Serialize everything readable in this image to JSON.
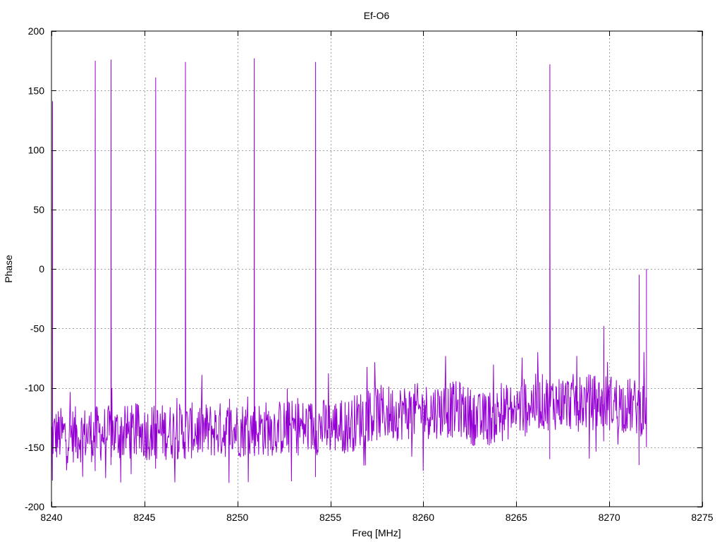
{
  "chart_data": {
    "type": "line",
    "title": "Ef-O6",
    "xlabel": "Freq [MHz]",
    "ylabel": "Phase",
    "xlim": [
      8240,
      8275
    ],
    "ylim": [
      -200,
      200
    ],
    "xticks": [
      8240,
      8245,
      8250,
      8255,
      8260,
      8265,
      8270,
      8275
    ],
    "yticks": [
      -200,
      -150,
      -100,
      -50,
      0,
      50,
      100,
      150,
      200
    ],
    "grid": true,
    "line_color": "#9400d3",
    "series": [
      {
        "x_start": 8240,
        "x_end": 8272,
        "baseline": [
          [
            8240,
            -140
          ],
          [
            8256,
            -132
          ],
          [
            8257,
            -122
          ],
          [
            8262,
            -118
          ],
          [
            8263,
            -128
          ],
          [
            8265,
            -118
          ],
          [
            8266,
            -112
          ],
          [
            8270,
            -112
          ],
          [
            8272,
            -118
          ]
        ],
        "noise_amplitude": 24,
        "spikes": [
          {
            "x": 8240.05,
            "peak": 141,
            "mid": 3,
            "low": -178
          },
          {
            "x": 8242.35,
            "peak": 175,
            "mid": 11,
            "low": -170
          },
          {
            "x": 8243.2,
            "peak": 176,
            "mid": 16,
            "low": -165
          },
          {
            "x": 8245.6,
            "peak": 161,
            "mid": 9,
            "low": -168
          },
          {
            "x": 8247.2,
            "peak": 174,
            "mid": 15,
            "low": -160
          },
          {
            "x": 8250.9,
            "peak": 177,
            "mid": 15,
            "low": -155
          },
          {
            "x": 8254.2,
            "peak": 174,
            "mid": 12,
            "low": -175
          },
          {
            "x": 8266.8,
            "peak": 172,
            "mid": 20,
            "low": -160
          },
          {
            "x": 8269.7,
            "peak": -48,
            "mid": -70,
            "low": -145
          },
          {
            "x": 8271.6,
            "peak": -5,
            "mid": -60,
            "low": -165
          },
          {
            "x": 8272.0,
            "peak": 0,
            "mid": -60,
            "low": -150
          }
        ]
      }
    ]
  }
}
